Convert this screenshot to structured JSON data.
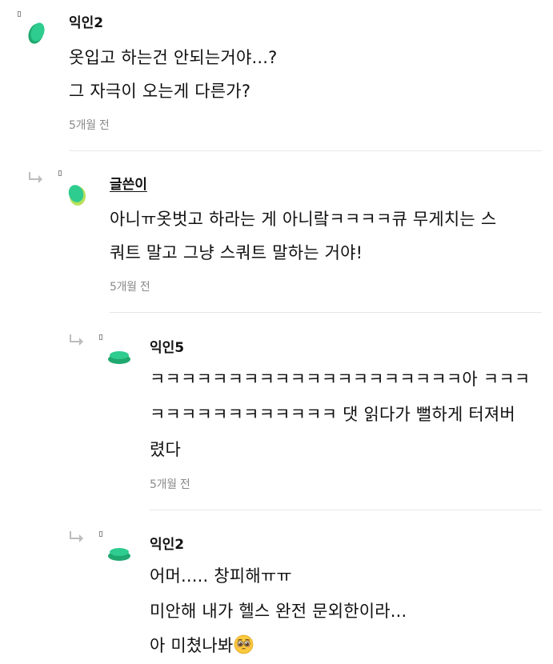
{
  "colors": {
    "avatar_green": "#2ecc8e",
    "avatar_green_dark": "#1fa86f",
    "avatar_yellow": "#b8e05a",
    "muted_text": "#8a8a8a",
    "divider": "#e6e6e6"
  },
  "comments": [
    {
      "author": "익인2",
      "lines": [
        "옷입고 하는건 안되는거야...?",
        "그 자극이 오는게 다른가?"
      ],
      "time": "5개월 전"
    },
    {
      "author": "글쓴이",
      "lines": [
        "아니ㅠ옷벗고 하라는 게 아니랔ㅋㅋㅋㅋ큐 무게치는 스",
        "쿼트 말고 그냥 스쿼트 말하는 거야!"
      ],
      "time": "5개월 전"
    },
    {
      "author": "익인5",
      "lines": [
        "ㅋㅋㅋㅋㅋㅋㅋㅋㅋㅋㅋㅋㅋㅋㅋㅋㅋㅋㅋㅋ아 ㅋㅋㅋ",
        "ㅋㅋㅋㅋㅋㅋㅋㅋㅋㅋㅋㅋ 댓 읽다가 뻘하게 터져버",
        "렸다"
      ],
      "time": "5개월 전"
    },
    {
      "author": "익인2",
      "lines": [
        "어머..... 창피해ㅠㅠ",
        "미안해 내가 헬스 완전 문외한이라...",
        "아 미쳤나봐"
      ],
      "emoji_icon": "pleading-face-emoji"
    }
  ]
}
